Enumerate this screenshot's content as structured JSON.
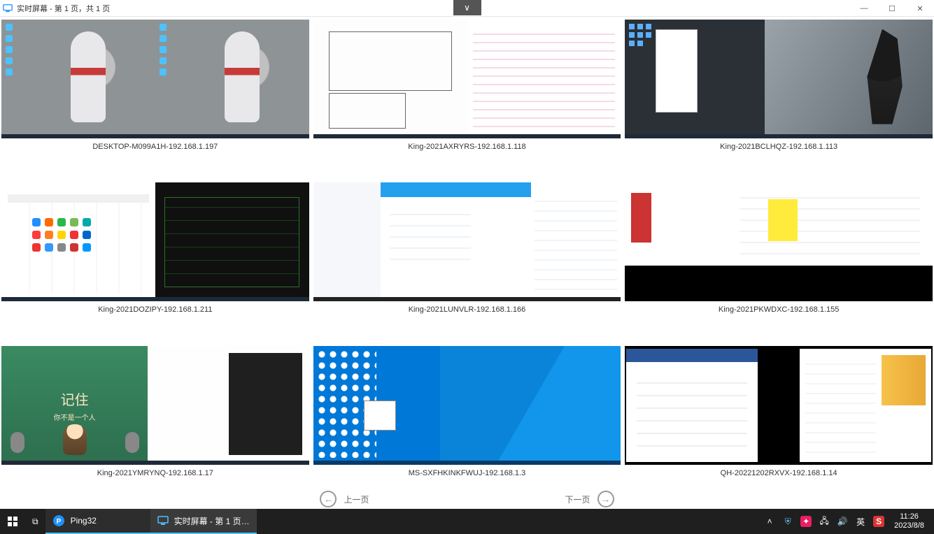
{
  "titlebar": {
    "title": "实时屏幕 - 第 1 页，共 1 页",
    "dropdown_glyph": "∨",
    "min_glyph": "—",
    "max_glyph": "☐",
    "close_glyph": "✕"
  },
  "screens": [
    {
      "label": "DESKTOP-M099A1H-192.168.1.197",
      "style": "ultra"
    },
    {
      "label": "King-2021AXRYRS-192.168.1.118",
      "style": "cad"
    },
    {
      "label": "King-2021BCLHQZ-192.168.1.113",
      "style": "samurai"
    },
    {
      "label": "King-2021DOZIPY-192.168.1.211",
      "style": "browsercad"
    },
    {
      "label": "King-2021LUNVLR-192.168.1.166",
      "style": "qq"
    },
    {
      "label": "King-2021PKWDXC-192.168.1.155",
      "style": "erp"
    },
    {
      "label": "King-2021YMRYNQ-192.168.1.17",
      "style": "monk",
      "big_text": "记住",
      "sub_text": "你不是一个人"
    },
    {
      "label": "MS-SXFHKINKFWUJ-192.168.1.3",
      "style": "winblue"
    },
    {
      "label": "QH-20221202RXVX-192.168.1.14",
      "style": "office"
    }
  ],
  "pager": {
    "prev": "上一页",
    "next": "下一页",
    "prev_glyph": "←",
    "next_glyph": "→"
  },
  "taskbar": {
    "start_glyph": "⊞",
    "taskview_glyph": "⧉",
    "ping32": {
      "label": "Ping32"
    },
    "active": {
      "label": "实时屏幕 - 第 1 页…"
    },
    "tray": {
      "ime": "英",
      "sogou": "S",
      "net_glyph": "🖧",
      "vol_glyph": "🔊",
      "up_glyph": "˄",
      "shield_glyph": "⛨",
      "pink_glyph": "✦"
    },
    "clock": {
      "time": "11:26",
      "date": "2023/8/8"
    }
  }
}
